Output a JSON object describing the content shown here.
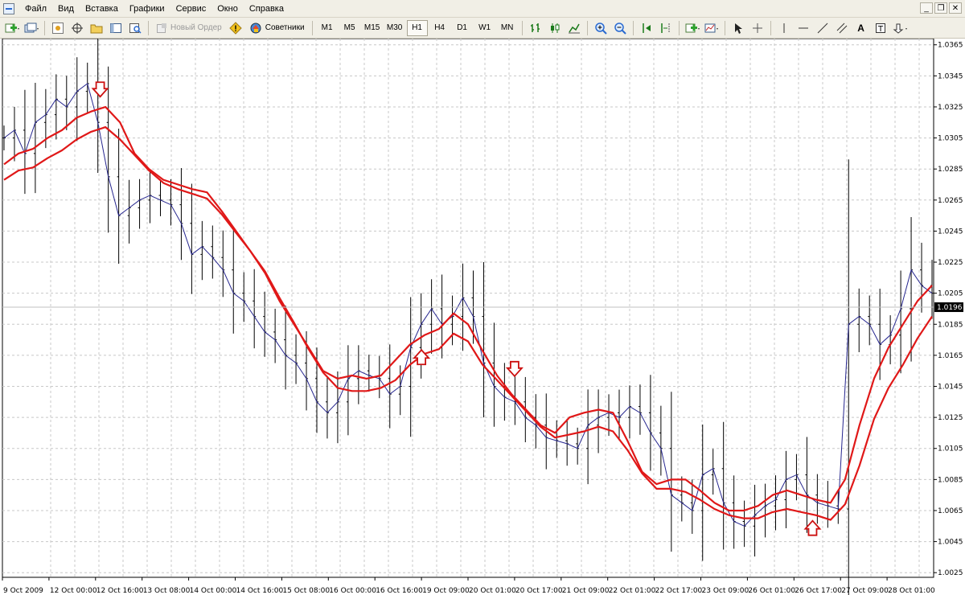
{
  "menu": [
    "Файл",
    "Вид",
    "Вставка",
    "Графики",
    "Сервис",
    "Окно",
    "Справка"
  ],
  "toolbar": {
    "new_order": "Новый Ордер",
    "advisors": "Советники",
    "timeframes": [
      "M1",
      "M5",
      "M15",
      "M30",
      "H1",
      "H4",
      "D1",
      "W1",
      "MN"
    ],
    "active_timeframe": "H1",
    "text_tool": "A"
  },
  "colors": {
    "ma": "#e01818",
    "price_line": "#26268f",
    "bars": "#000000",
    "grid": "#c8c8c8"
  },
  "icons": {
    "new-chart": "green-plus-window",
    "profiles": "window-stack",
    "crosshair": "crosshair",
    "navigator": "folder",
    "zoom-in": "magnifier-plus",
    "zoom-out": "magnifier-minus",
    "cursor": "arrow"
  },
  "chart_data": {
    "type": "line",
    "y_ticks": [
      "1.0365",
      "1.0345",
      "1.0325",
      "1.0305",
      "1.0285",
      "1.0265",
      "1.0245",
      "1.0225",
      "1.0205",
      "1.0185",
      "1.0165",
      "1.0145",
      "1.0125",
      "1.0105",
      "1.0085",
      "1.0065",
      "1.0045",
      "1.0025"
    ],
    "x_ticks": [
      "9 Oct 2009",
      "12 Oct 00:00",
      "12 Oct 16:00",
      "13 Oct 08:00",
      "14 Oct 00:00",
      "14 Oct 16:00",
      "15 Oct 08:00",
      "16 Oct 00:00",
      "16 Oct 16:00",
      "19 Oct 09:00",
      "20 Oct 01:00",
      "20 Oct 17:00",
      "21 Oct 09:00",
      "22 Oct 01:00",
      "22 Oct 17:00",
      "23 Oct 09:00",
      "26 Oct 01:00",
      "26 Oct 17:00",
      "27 Oct 09:00",
      "28 Oct 01:00"
    ],
    "current_price": "1.0196",
    "ylim": [
      1.0022,
      1.0369
    ],
    "price": [
      1.0305,
      1.031,
      1.0295,
      1.0315,
      1.032,
      1.033,
      1.0325,
      1.0335,
      1.034,
      1.0315,
      1.028,
      1.0255,
      1.026,
      1.0265,
      1.0268,
      1.0265,
      1.0262,
      1.025,
      1.023,
      1.0235,
      1.0228,
      1.022,
      1.0205,
      1.02,
      1.019,
      1.018,
      1.0175,
      1.0165,
      1.016,
      1.015,
      1.0135,
      1.0128,
      1.0135,
      1.015,
      1.0155,
      1.0152,
      1.015,
      1.014,
      1.0145,
      1.017,
      1.0185,
      1.0195,
      1.0185,
      1.019,
      1.0202,
      1.019,
      1.016,
      1.0145,
      1.0138,
      1.0135,
      1.0125,
      1.012,
      1.0112,
      1.011,
      1.0108,
      1.0105,
      1.012,
      1.0125,
      1.0128,
      1.0125,
      1.0132,
      1.0128,
      1.0115,
      1.0105,
      1.0075,
      1.007,
      1.0065,
      1.0088,
      1.0092,
      1.007,
      1.0058,
      1.0055,
      1.0062,
      1.0068,
      1.0072,
      1.0085,
      1.0088,
      1.0075,
      1.007,
      1.0068,
      1.0066,
      1.0185,
      1.019,
      1.0185,
      1.0172,
      1.0178,
      1.0195,
      1.022,
      1.021,
      1.0205
    ],
    "ma_fast": [
      1.0288,
      1.0295,
      1.0298,
      1.0305,
      1.031,
      1.0318,
      1.0322,
      1.0325,
      1.0315,
      1.0295,
      1.0285,
      1.0278,
      1.0275,
      1.0272,
      1.027,
      1.0258,
      1.0245,
      1.0232,
      1.0218,
      1.02,
      1.0185,
      1.017,
      1.0155,
      1.015,
      1.0152,
      1.015,
      1.0152,
      1.0162,
      1.0172,
      1.0178,
      1.0182,
      1.0192,
      1.0185,
      1.0168,
      1.0152,
      1.014,
      1.013,
      1.012,
      1.0115,
      1.0125,
      1.0128,
      1.013,
      1.0128,
      1.011,
      1.009,
      1.0082,
      1.0085,
      1.0085,
      1.0078,
      1.007,
      1.0065,
      1.0065,
      1.0068,
      1.0075,
      1.0078,
      1.0075,
      1.0072,
      1.007,
      1.0085,
      1.012,
      1.015,
      1.017,
      1.0185,
      1.02,
      1.021
    ],
    "ma_slow": [
      1.0284,
      1.029,
      1.0292,
      1.0298,
      1.0303,
      1.031,
      1.0315,
      1.0318,
      1.031,
      1.03,
      1.029,
      1.0282,
      1.0278,
      1.0275,
      1.0272,
      1.0262,
      1.025,
      1.0238,
      1.0225,
      1.0208,
      1.0192,
      1.0175,
      1.016,
      1.015,
      1.0148,
      1.0148,
      1.015,
      1.0155,
      1.0165,
      1.0172,
      1.0175,
      1.0185,
      1.018,
      1.0165,
      1.0155,
      1.0145,
      1.0135,
      1.0125,
      1.0118,
      1.012,
      1.0122,
      1.0125,
      1.0122,
      1.011,
      1.0095,
      1.0085,
      1.0085,
      1.0083,
      1.0078,
      1.0072,
      1.0068,
      1.0066,
      1.0066,
      1.007,
      1.0072,
      1.007,
      1.0068,
      1.0065,
      1.0075,
      1.01,
      1.013,
      1.015,
      1.0165,
      1.0182,
      1.0196
    ],
    "signals": [
      {
        "type": "sell",
        "at": 0.105
      },
      {
        "type": "buy",
        "at": 0.45
      },
      {
        "type": "sell",
        "at": 0.55
      },
      {
        "type": "buy",
        "at": 0.87
      }
    ]
  }
}
